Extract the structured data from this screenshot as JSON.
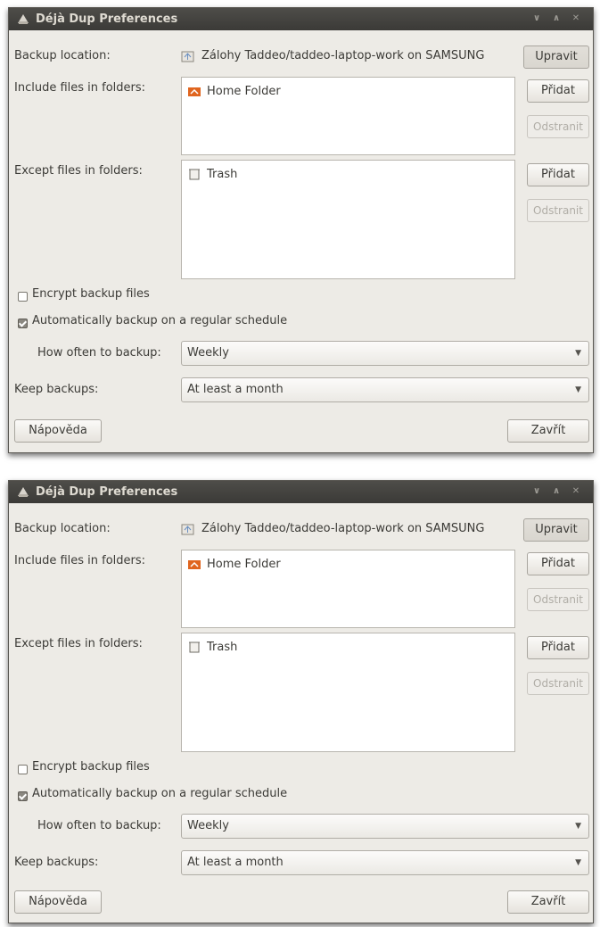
{
  "windows": [
    {
      "title": "Déjà Dup Preferences",
      "backup_location_label": "Backup location:",
      "backup_location_value": "Zálohy Taddeo/taddeo-laptop-work on SAMSUNG",
      "change_button": "Upravit",
      "include_label": "Include files in folders:",
      "include_items": [
        "Home Folder"
      ],
      "include_add": "Přidat",
      "include_remove": "Odstranit",
      "except_label": "Except files in folders:",
      "except_items": [
        "Trash"
      ],
      "except_add": "Přidat",
      "except_remove": "Odstranit",
      "encrypt_label": "Encrypt backup files",
      "encrypt_checked": false,
      "auto_label": "Automatically backup on a regular schedule",
      "auto_checked": true,
      "how_often_label": "How often to backup:",
      "how_often_value": "Weekly",
      "keep_label": "Keep backups:",
      "keep_value": "At least a month",
      "help_button": "Nápověda",
      "close_button": "Zavřít"
    },
    {
      "title": "Déjà Dup Preferences",
      "backup_location_label": "Backup location:",
      "backup_location_value": "Zálohy Taddeo/taddeo-laptop-work on SAMSUNG",
      "change_button": "Upravit",
      "include_label": "Include files in folders:",
      "include_items": [
        "Home Folder"
      ],
      "include_add": "Přidat",
      "include_remove": "Odstranit",
      "except_label": "Except files in folders:",
      "except_items": [
        "Trash"
      ],
      "except_add": "Přidat",
      "except_remove": "Odstranit",
      "encrypt_label": "Encrypt backup files",
      "encrypt_checked": false,
      "auto_label": "Automatically backup on a regular schedule",
      "auto_checked": true,
      "how_often_label": "How often to backup:",
      "how_often_value": "Weekly",
      "keep_label": "Keep backups:",
      "keep_value": "At least a month",
      "help_button": "Nápověda",
      "close_button": "Zavřít"
    }
  ],
  "icons": {
    "app": "deja-dup-icon",
    "location": "drive-icon",
    "home": "home-folder-icon",
    "trash": "trash-icon"
  },
  "colors": {
    "window_bg": "#edebe6",
    "titlebar": "#3b3a37",
    "text": "#3c3b37"
  }
}
